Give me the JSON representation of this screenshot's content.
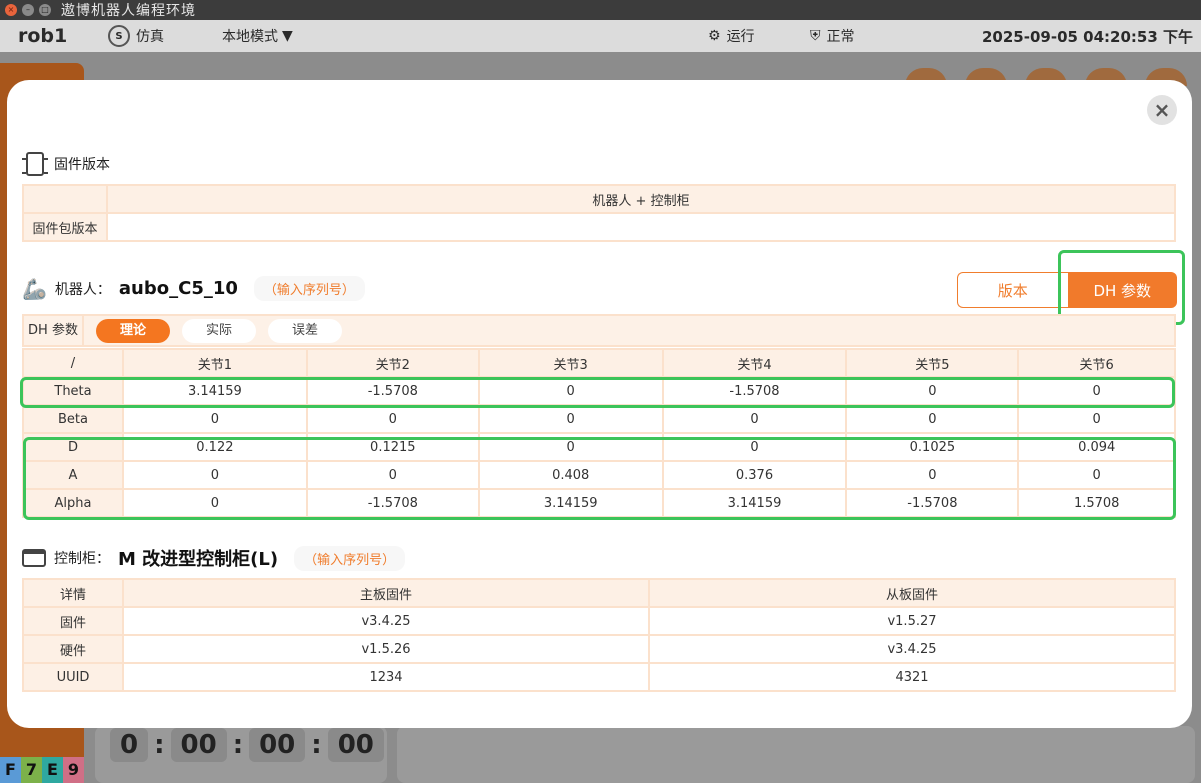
{
  "window": {
    "title": "遨博机器人编程环境",
    "buttons": [
      "×",
      "–",
      "□"
    ]
  },
  "appbar": {
    "robot": "rob1",
    "sim_label": "仿真",
    "mode_label": "本地模式",
    "run_label": "运行",
    "status_label": "正常",
    "datetime": "2025-09-05 04:20:53 下午"
  },
  "background": {
    "timer": [
      "0",
      "00",
      "00",
      "00"
    ],
    "keys": [
      "F",
      "7",
      "E",
      "9"
    ]
  },
  "modal": {
    "close_glyph": "×",
    "firmware": {
      "title": "固件版本",
      "header": "机器人 + 控制柜",
      "row_label": "固件包版本",
      "row_value": ""
    },
    "robot": {
      "label": "机器人：",
      "model": "aubo_C5_10",
      "serial_hint": "（输入序列号）",
      "tab_version": "版本",
      "tab_dh": "DH 参数",
      "dh_label": "DH 参数",
      "pills": [
        "理论",
        "实际",
        "误差"
      ],
      "columns": [
        "/",
        "关节1",
        "关节2",
        "关节3",
        "关节4",
        "关节5",
        "关节6"
      ],
      "rows": [
        {
          "name": "Theta",
          "values": [
            "3.14159",
            "-1.5708",
            "0",
            "-1.5708",
            "0",
            "0"
          ]
        },
        {
          "name": "Beta",
          "values": [
            "0",
            "0",
            "0",
            "0",
            "0",
            "0"
          ]
        },
        {
          "name": "D",
          "values": [
            "0.122",
            "0.1215",
            "0",
            "0",
            "0.1025",
            "0.094"
          ]
        },
        {
          "name": "A",
          "values": [
            "0",
            "0",
            "0.408",
            "0.376",
            "0",
            "0"
          ]
        },
        {
          "name": "Alpha",
          "values": [
            "0",
            "-1.5708",
            "3.14159",
            "3.14159",
            "-1.5708",
            "1.5708"
          ]
        }
      ]
    },
    "cabinet": {
      "label": "控制柜：",
      "model": "M 改进型控制柜(L)",
      "serial_hint": "（输入序列号）",
      "columns": [
        "详情",
        "主板固件",
        "从板固件"
      ],
      "rows": [
        {
          "name": "固件",
          "values": [
            "v3.4.25",
            "v1.5.27"
          ]
        },
        {
          "name": "硬件",
          "values": [
            "v1.5.26",
            "v3.4.25"
          ]
        },
        {
          "name": "UUID",
          "values": [
            "1234",
            "4321"
          ]
        }
      ]
    }
  }
}
